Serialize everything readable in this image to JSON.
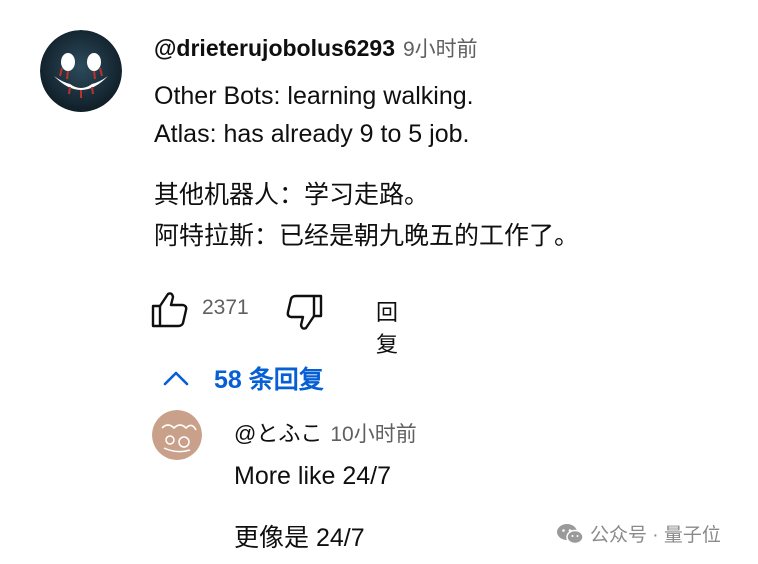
{
  "comment": {
    "username": "@drieterujobolus6293",
    "timestamp": "9小时前",
    "lines": [
      "Other Bots: learning walking.",
      "Atlas: has already 9 to 5 job.",
      "其他机器人：学习走路。",
      "阿特拉斯：已经是朝九晚五的工作了。"
    ],
    "like_count": "2371",
    "reply_label": "回复",
    "replies_toggle": "58 条回复"
  },
  "reply": {
    "username": "@とふこ",
    "timestamp": "10小时前",
    "lines": [
      "More like 24/7",
      "更像是 24/7"
    ]
  },
  "watermark": {
    "text": "公众号 · 量子位"
  },
  "icons": {
    "avatar": "smiley-face-avatar",
    "like": "thumbs-up-icon",
    "dislike": "thumbs-down-icon",
    "toggle": "chevron-up-icon",
    "watermark": "wechat-icon"
  },
  "colors": {
    "link": "#065fd4",
    "muted": "#606060",
    "text": "#0f0f0f"
  }
}
